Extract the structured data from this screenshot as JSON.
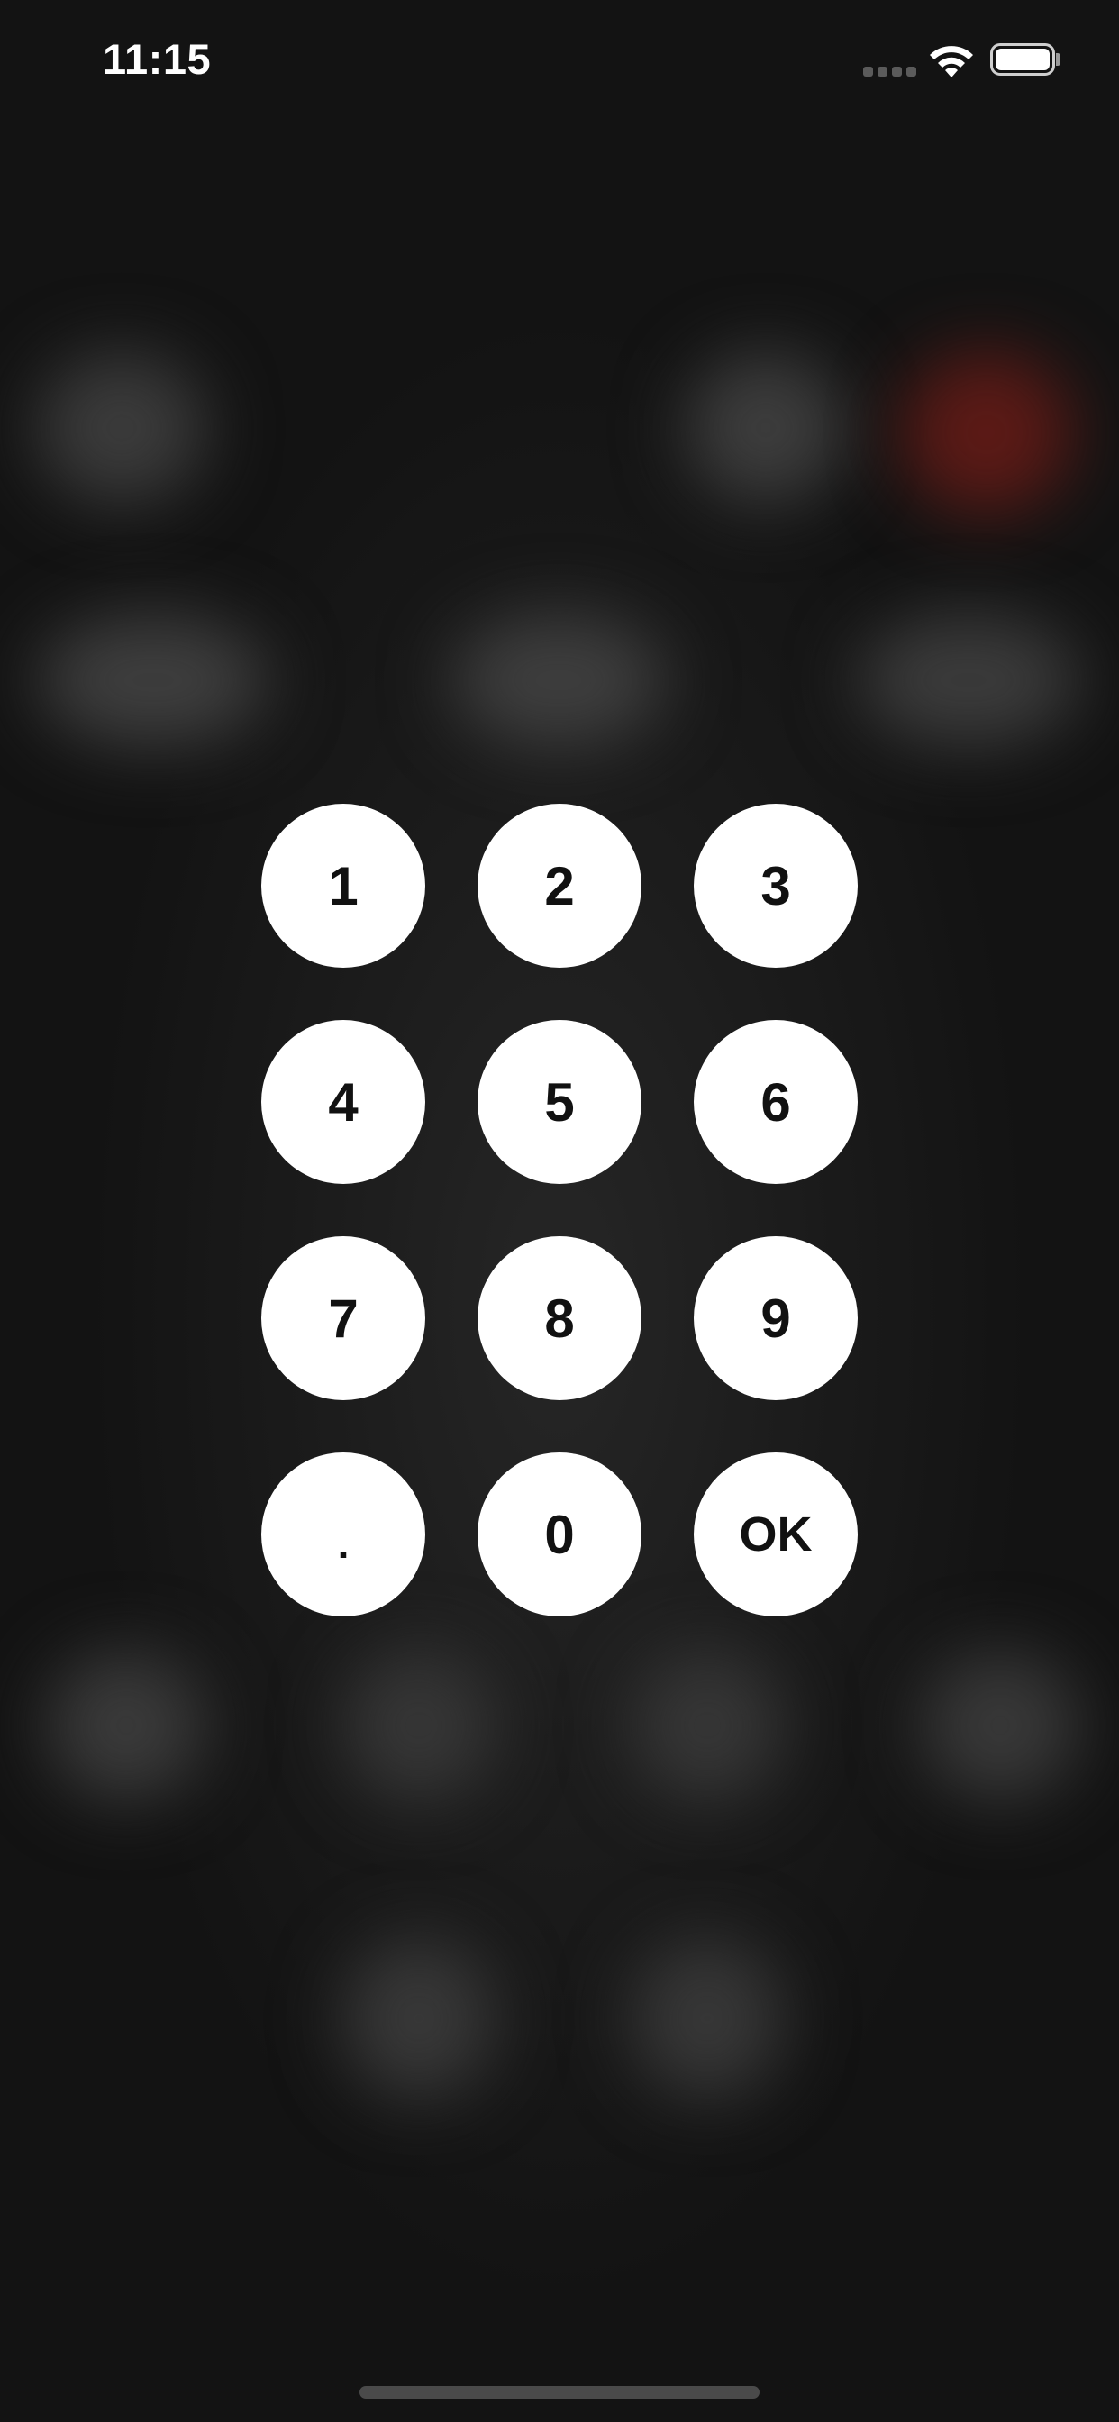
{
  "status_bar": {
    "time": "11:15",
    "wifi_icon": "wifi-icon",
    "battery_icon": "battery-icon",
    "signal_icon": "cellular-signal-icon"
  },
  "keypad": {
    "keys": [
      "1",
      "2",
      "3",
      "4",
      "5",
      "6",
      "7",
      "8",
      "9",
      ".",
      "0",
      "OK"
    ]
  },
  "background": {
    "base_color": "#141414",
    "accent_blur_color": "#5c1a16",
    "blur_blob_color": "#474747"
  },
  "colors": {
    "key_background": "#ffffff",
    "key_text": "#111111",
    "home_indicator": "#4a4a4a"
  }
}
